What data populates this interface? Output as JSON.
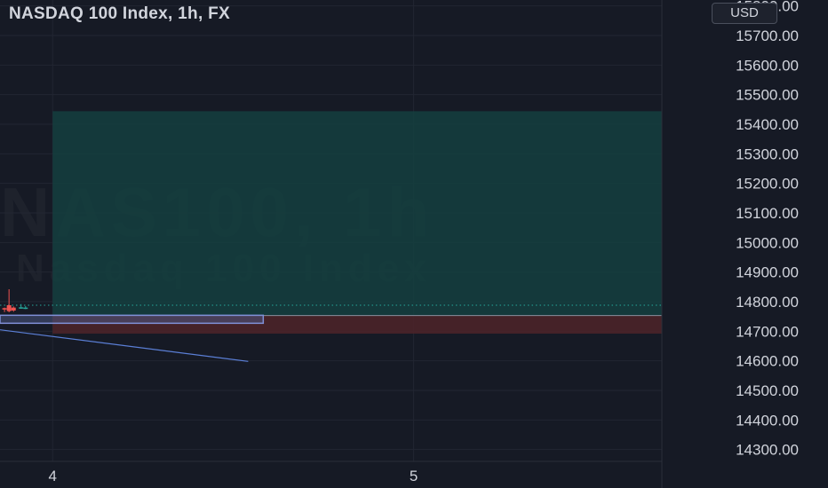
{
  "header": {
    "title": "NASDAQ 100 Index, 1h, FX",
    "currency_button": "USD"
  },
  "watermark": {
    "line1": "NAS100, 1h",
    "line2": "Nasdaq 100 Index"
  },
  "colors": {
    "background": "#161a25",
    "grid": "#222632",
    "text": "#d1d4dc",
    "profit_zone": "#14403f",
    "stop_zone": "#4a2329",
    "price_line": "#26a69a",
    "up_candle": "#26a69a",
    "down_candle": "#ef5350",
    "range_box_fill": "#4a5580",
    "range_box_border": "#7f8fd6",
    "trendline": "#5b7fd6"
  },
  "chart_data": {
    "type": "candlestick-position",
    "y_axis": {
      "ticks": [
        15700,
        15600,
        15500,
        15400,
        15300,
        15200,
        15100,
        15000,
        14900,
        14800,
        14700,
        14600,
        14500,
        14400,
        14300
      ],
      "tick_labels": [
        "15700.00",
        "15600.00",
        "15500.00",
        "15400.00",
        "15300.00",
        "15200.00",
        "15100.00",
        "15000.00",
        "14900.00",
        "14800.00",
        "14700.00",
        "14600.00",
        "14500.00",
        "14400.00",
        "14300.00"
      ],
      "partial_top_label": "15800.00",
      "ylim": [
        14260,
        15820
      ]
    },
    "x_axis": {
      "ticks": [
        {
          "label": "4",
          "hour": 0
        },
        {
          "label": "5",
          "hour": 24
        }
      ],
      "xlim_hours": [
        -3.5,
        40.5
      ]
    },
    "candles": [
      {
        "hour": -3.2,
        "open": 14778,
        "close": 14774,
        "high": 14780,
        "low": 14765
      },
      {
        "hour": -2.9,
        "open": 14788,
        "close": 14768,
        "high": 14842,
        "low": 14764
      },
      {
        "hour": -2.6,
        "open": 14780,
        "close": 14770,
        "high": 14784,
        "low": 14766
      },
      {
        "hour": -2.1,
        "open": 14778,
        "close": 14781,
        "high": 14792,
        "low": 14776
      },
      {
        "hour": -1.8,
        "open": 14777,
        "close": 14780,
        "high": 14785,
        "low": 14775
      }
    ],
    "current_price": 14788,
    "position": {
      "start_hour": 0,
      "end_hour": 40.5,
      "entry": 14753,
      "take_profit": 15444,
      "stop_loss": 14692
    },
    "range_box": {
      "start_hour": -3.5,
      "end_hour": 14,
      "top": 14754,
      "bottom": 14727
    },
    "trendline": {
      "x1_hour": -3.5,
      "y1": 14705,
      "x2_hour": 13,
      "y2": 14598
    },
    "grid": true
  }
}
